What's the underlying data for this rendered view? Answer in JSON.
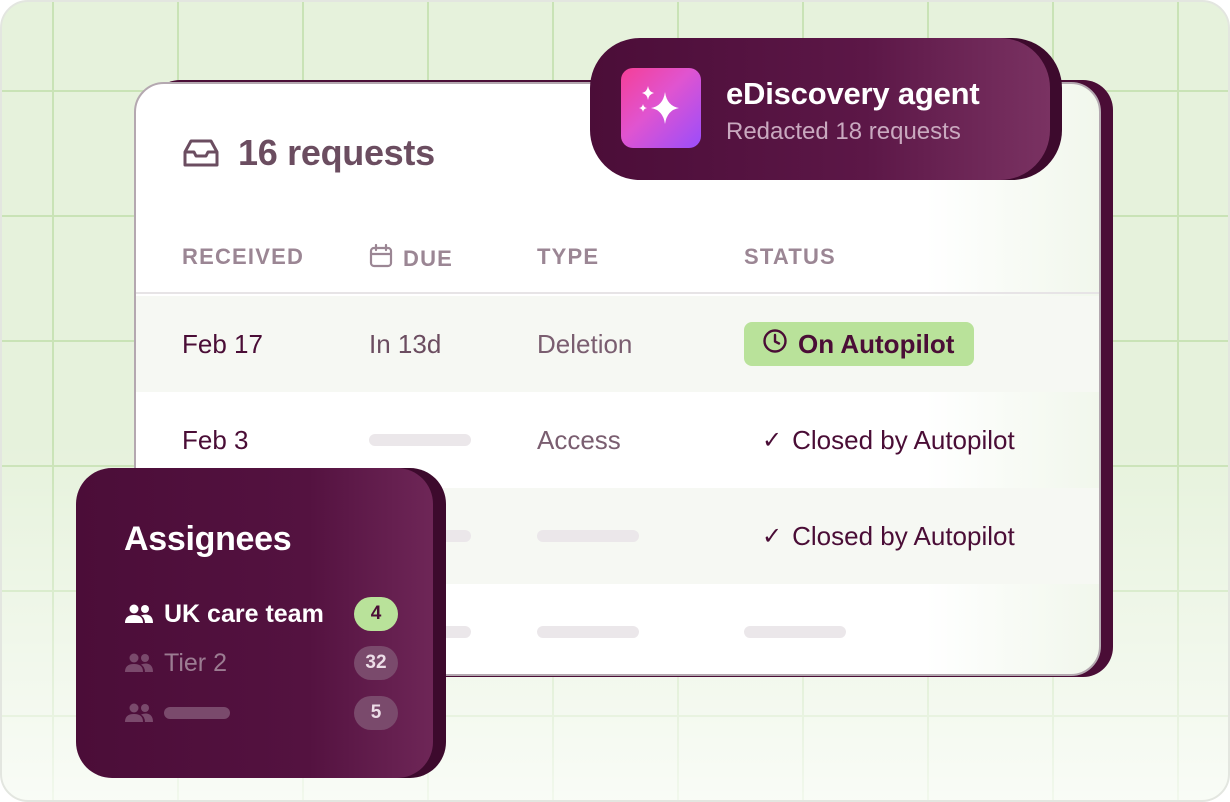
{
  "requests_card": {
    "title": "16 requests",
    "columns": {
      "received": "RECEIVED",
      "due": "DUE",
      "type": "TYPE",
      "status": "STATUS"
    },
    "rows": [
      {
        "received": "Feb 17",
        "due": "In 13d",
        "type": "Deletion",
        "status": "On Autopilot"
      },
      {
        "received": "Feb 3",
        "due": "",
        "type": "Access",
        "status": "Closed by Autopilot"
      },
      {
        "received": "",
        "due": "",
        "type": "",
        "status": "Closed by Autopilot"
      },
      {
        "received": "",
        "due": "",
        "type": "",
        "status": ""
      }
    ]
  },
  "agent": {
    "title": "eDiscovery agent",
    "subtitle": "Redacted 18 requests"
  },
  "assignees": {
    "title": "Assignees",
    "items": [
      {
        "label": "UK care team",
        "count": "4"
      },
      {
        "label": "Tier 2",
        "count": "32"
      },
      {
        "label": "",
        "count": "5"
      }
    ]
  },
  "colors": {
    "brand_dark": "#4a0d36",
    "accent_green": "#b9e29a",
    "grid_background": "#e6f2dc",
    "sparkle_gradient": [
      "#f53f97",
      "#9a4dfb"
    ]
  },
  "icons": [
    "inbox-icon",
    "calendar-icon",
    "clock-icon",
    "check-icon",
    "sparkles-icon",
    "people-icon"
  ]
}
